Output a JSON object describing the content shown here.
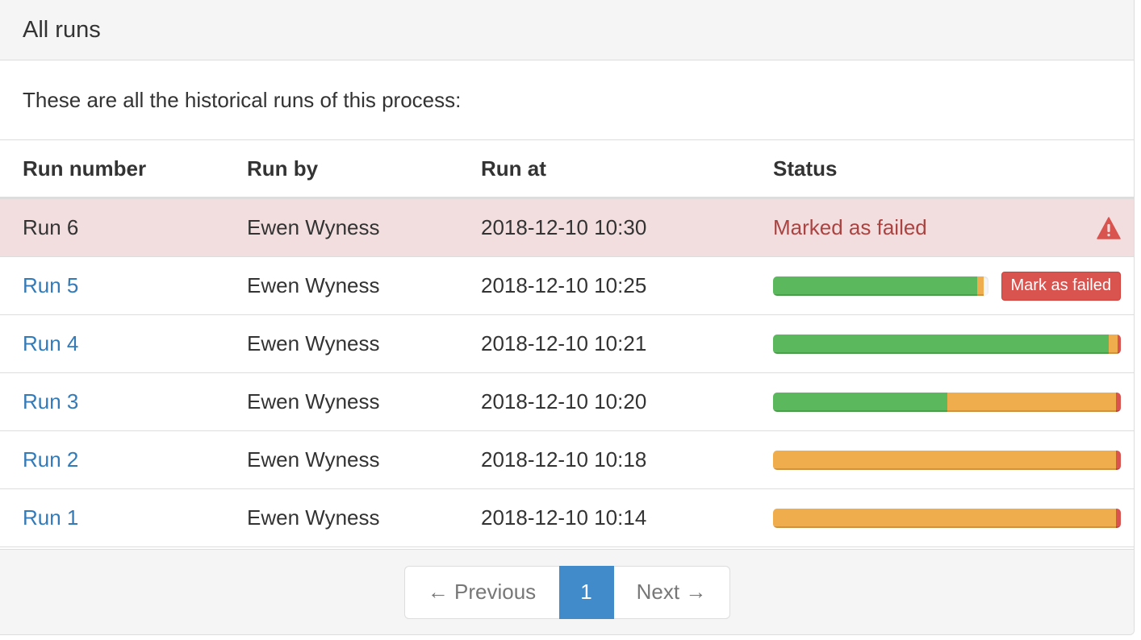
{
  "panel": {
    "title": "All runs",
    "description": "These are all the historical runs of this process:"
  },
  "table": {
    "headers": [
      "Run number",
      "Run by",
      "Run at",
      "Status"
    ],
    "rows": [
      {
        "run": "Run 6",
        "by": "Ewen Wyness",
        "at": "2018-12-10 10:30",
        "status_text": "Marked as failed",
        "link": false
      },
      {
        "run": "Run 5",
        "by": "Ewen Wyness",
        "at": "2018-12-10 10:25",
        "link": true,
        "progress": {
          "success": 95,
          "warning": 3,
          "danger": 0
        },
        "action": "Mark as failed"
      },
      {
        "run": "Run 4",
        "by": "Ewen Wyness",
        "at": "2018-12-10 10:21",
        "link": true,
        "progress": {
          "success": 96.5,
          "warning": 2.5,
          "danger": 1
        }
      },
      {
        "run": "Run 3",
        "by": "Ewen Wyness",
        "at": "2018-12-10 10:20",
        "link": true,
        "progress": {
          "success": 50,
          "warning": 48.5,
          "danger": 1.5
        }
      },
      {
        "run": "Run 2",
        "by": "Ewen Wyness",
        "at": "2018-12-10 10:18",
        "link": true,
        "progress": {
          "success": 0,
          "warning": 98.5,
          "danger": 1.5
        }
      },
      {
        "run": "Run 1",
        "by": "Ewen Wyness",
        "at": "2018-12-10 10:14",
        "link": true,
        "progress": {
          "success": 0,
          "warning": 98.5,
          "danger": 1.5
        }
      }
    ]
  },
  "pagination": {
    "previous": "← Previous",
    "current": "1",
    "next": "Next →"
  },
  "icons": {
    "row6_status": "warning-icon"
  },
  "colors": {
    "success": "#5cb85c",
    "warning": "#f0ad4e",
    "danger": "#d9534f",
    "link": "#337ab7",
    "danger_row": "#f2dede"
  }
}
